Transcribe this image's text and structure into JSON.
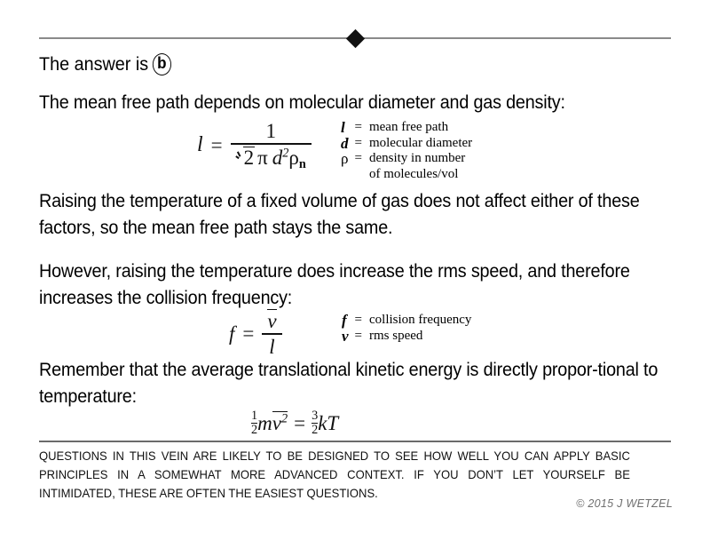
{
  "slide": {
    "answer_prefix": "The answer is",
    "answer_choice": "b",
    "paragraph_1": "The mean free path depends on molecular diameter and gas density:",
    "paragraph_2": "Raising the temperature of a fixed volume of gas does not affect either of these factors, so the mean free path stays the same.",
    "paragraph_3": "However, raising the temperature does increase the rms speed, and therefore increases the collision frequency:",
    "paragraph_4": "Remember that the average translational kinetic energy is directly propor-tional to temperature:",
    "footer_note": "QUESTIONS IN THIS VEIN ARE LIKELY TO BE DESIGNED TO SEE HOW WELL YOU CAN APPLY BASIC PRINCIPLES IN A SOMEWHAT MORE ADVANCED CONTEXT.  IF YOU DON’T LET YOURSELF BE INTIMIDATED, THESE ARE OFTEN THE EASIEST QUESTIONS.",
    "copyright": "© 2015 J WETZEL"
  },
  "equation_1": {
    "lhs": "l",
    "equals": "=",
    "numerator": "1",
    "denominator_sqrt_radicand": "2",
    "denominator_pi": "π",
    "denominator_d": "d",
    "denominator_d_exponent": "2",
    "denominator_rho": "ρ",
    "denominator_rho_subscript": "n",
    "legend": [
      {
        "symbol": "l",
        "style": "bold-italic",
        "equals": "=",
        "definition": "mean free path"
      },
      {
        "symbol": "d",
        "style": "bold-italic",
        "equals": "=",
        "definition": "molecular diameter"
      },
      {
        "symbol": "ρ",
        "style": "upright",
        "equals": "=",
        "definition": "density in number"
      },
      {
        "symbol": "",
        "style": "upright",
        "equals": "",
        "definition": "of molecules/vol"
      }
    ]
  },
  "equation_2": {
    "lhs": "f",
    "equals": "=",
    "numerator": "v",
    "numerator_overbar": true,
    "denominator": "l",
    "legend": [
      {
        "symbol": "f",
        "style": "bold-italic",
        "equals": "=",
        "definition": "collision frequency"
      },
      {
        "symbol": "v",
        "style": "bold-italic",
        "equals": "=",
        "definition": "rms speed"
      }
    ]
  },
  "equation_3": {
    "lhs_fraction_numerator": "1",
    "lhs_fraction_denominator": "2",
    "lhs_mass": "m",
    "lhs_velocity": "v",
    "lhs_velocity_exponent": "2",
    "equals": "=",
    "rhs_fraction_numerator": "3",
    "rhs_fraction_denominator": "2",
    "rhs_boltzmann": "k",
    "rhs_temperature": "T"
  },
  "decor": {
    "diamond_icon": "diamond-bullet",
    "rule_color": "#8a8a8a"
  }
}
